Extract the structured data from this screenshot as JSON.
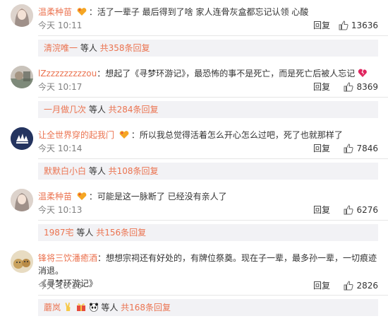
{
  "comments": [
    {
      "username": "温柔种苗",
      "text": "：活了一辈子 最后得到了啥 家人连骨灰盒都忘记认领 心酸",
      "time": "今天 10:11",
      "reply_label": "回复",
      "likes": "13636",
      "sub": {
        "user": "清浣唯一",
        "mid": " 等人 ",
        "total": "共358条回复"
      }
    },
    {
      "username": "lZzzzzzzzzzou",
      "text": "：想起了《寻梦环游记》，最恐怖的事不是死亡，而是死亡后被人忘记",
      "time": "今天 10:17",
      "reply_label": "回复",
      "likes": "8369",
      "sub": {
        "user": "一月做几次",
        "mid": " 等人 ",
        "total": "共284条回复"
      }
    },
    {
      "username": "让全世界穿的起我门",
      "text": "：所以我总觉得活着怎么开心怎么过吧，死了也就那样了",
      "time": "今天 10:14",
      "reply_label": "回复",
      "likes": "7846",
      "sub": {
        "user": "默默白小白",
        "mid": " 等人 ",
        "total": "共108条回复"
      }
    },
    {
      "username": "温柔种苗",
      "text": "：可能是这一脉断了 已经没有亲人了",
      "time": "今天 10:13",
      "reply_label": "回复",
      "likes": "6276",
      "sub": {
        "user": "1987宅",
        "mid": " 等人 ",
        "total": "共156条回复"
      }
    },
    {
      "username": "锋将三饮潘癒酒",
      "text": "：想想宗祠还有好处的，有牌位祭奠。现在子一辈，最多孙一辈，一切痕迹消退。",
      "text2": "《寻梦环游记》",
      "time": "今天 10:16",
      "reply_label": "回复",
      "likes": "2826",
      "sub": {
        "user": "蘑岚",
        "mid": " 等人 ",
        "total": "共168条回复"
      }
    }
  ],
  "colors": {
    "accent": "#eb7350",
    "sub_bg": "#f2f2f5"
  },
  "icons": {
    "like": "thumbs-up-icon",
    "vip": "gold-heart-badge-icon",
    "broken_heart": "broken-heart-emoji"
  }
}
